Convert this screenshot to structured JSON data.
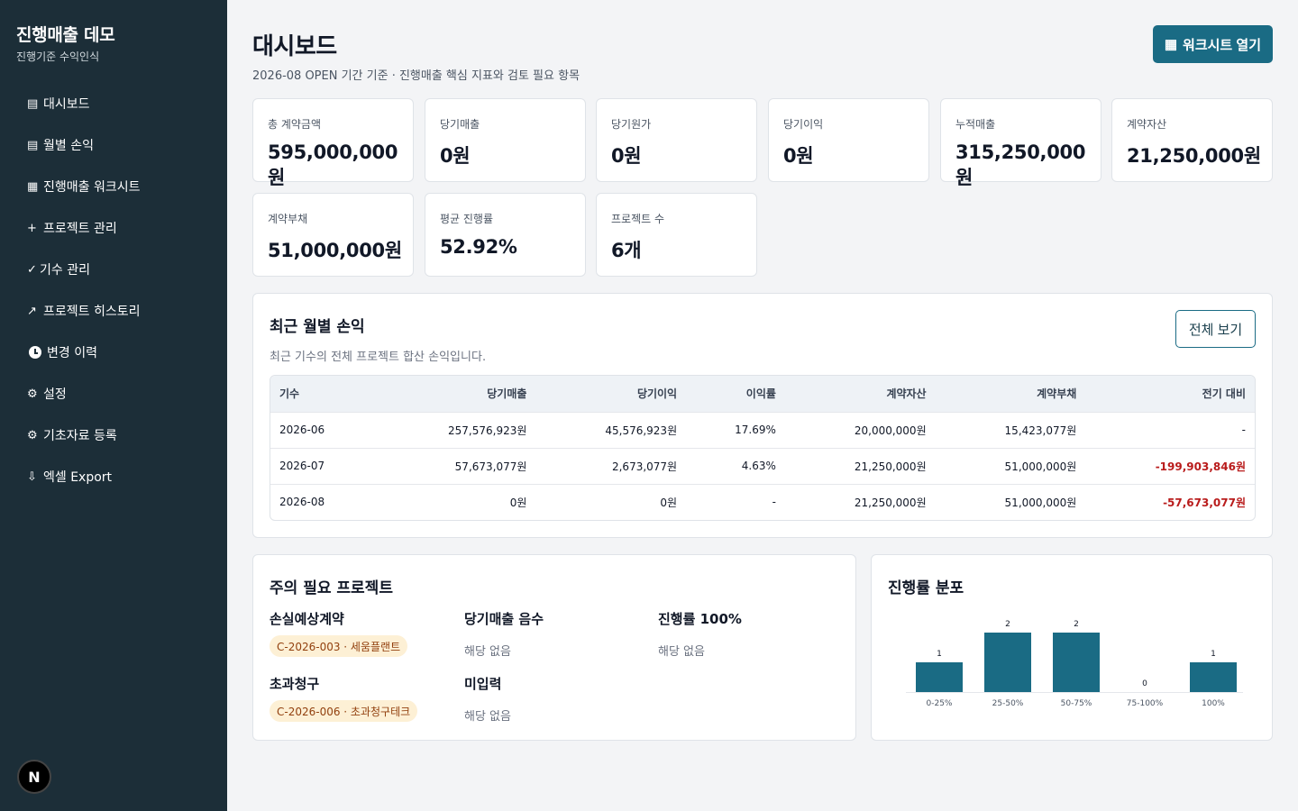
{
  "sidebar": {
    "title": "진행매출 데모",
    "subtitle": "진행기준 수익인식",
    "items": [
      {
        "icon": "▤",
        "label": "대시보드"
      },
      {
        "icon": "▤",
        "label": "월별 손익"
      },
      {
        "icon": "▦",
        "label": "진행매출 워크시트"
      },
      {
        "icon": "+",
        "label": "프로젝트 관리"
      },
      {
        "icon": "✓",
        "label": "기수 관리"
      },
      {
        "icon": "↗",
        "label": "프로젝트 히스토리"
      },
      {
        "icon": "clock",
        "label": "변경 이력"
      },
      {
        "icon": "⚙",
        "label": "설정"
      },
      {
        "icon": "⚙",
        "label": "기초자료 등록"
      },
      {
        "icon": "⇩",
        "label": "엑셀 Export"
      }
    ],
    "logo_letter": "N"
  },
  "header": {
    "title": "대시보드",
    "subtitle": "2026-08 OPEN 기간 기준 · 진행매출 핵심 지표와 검토 필요 항목",
    "worksheet_button": "워크시트 열기",
    "worksheet_icon": "▦"
  },
  "kpis": [
    {
      "label": "총 계약금액",
      "value": "595,000,000원"
    },
    {
      "label": "당기매출",
      "value": "0원"
    },
    {
      "label": "당기원가",
      "value": "0원"
    },
    {
      "label": "당기이익",
      "value": "0원"
    },
    {
      "label": "누적매출",
      "value": "315,250,000원"
    },
    {
      "label": "계약자산",
      "value": "21,250,000원"
    },
    {
      "label": "계약부채",
      "value": "51,000,000원"
    },
    {
      "label": "평균 진행률",
      "value": "52.92%"
    },
    {
      "label": "프로젝트 수",
      "value": "6개"
    }
  ],
  "monthly": {
    "title": "최근 월별 손익",
    "subtitle": "최근 기수의 전체 프로젝트 합산 손익입니다.",
    "view_all": "전체 보기",
    "columns": [
      "기수",
      "당기매출",
      "당기이익",
      "이익률",
      "계약자산",
      "계약부채",
      "전기 대비"
    ],
    "rows": [
      [
        "2026-06",
        "257,576,923원",
        "45,576,923원",
        "17.69%",
        "20,000,000원",
        "15,423,077원",
        "-"
      ],
      [
        "2026-07",
        "57,673,077원",
        "2,673,077원",
        "4.63%",
        "21,250,000원",
        "51,000,000원",
        "-199,903,846원"
      ],
      [
        "2026-08",
        "0원",
        "0원",
        "-",
        "21,250,000원",
        "51,000,000원",
        "-57,673,077원"
      ]
    ],
    "negative_color": "#b91c1c"
  },
  "attention": {
    "title": "주의 필요 프로젝트",
    "groups": {
      "loss": {
        "title": "손실예상계약",
        "pill": "C-2026-003 · 세움플랜트"
      },
      "neg_rev": {
        "title": "당기매출 음수",
        "empty": "해당 없음"
      },
      "full": {
        "title": "진행률 100%",
        "empty": "해당 없음"
      },
      "over": {
        "title": "초과청구",
        "pill": "C-2026-006 · 초과청구테크"
      },
      "missing": {
        "title": "미입력",
        "empty": "해당 없음"
      }
    }
  },
  "chart_data": {
    "type": "bar",
    "title": "진행률 분포",
    "categories": [
      "0-25%",
      "25-50%",
      "50-75%",
      "75-100%",
      "100%"
    ],
    "values": [
      1,
      2,
      2,
      0,
      1
    ],
    "ylim": [
      0,
      2
    ],
    "bar_color": "#1a6b84",
    "grid": false,
    "legend": "none"
  },
  "colors": {
    "sidebar_bg": "#1c2e38",
    "accent": "#1a6b84",
    "pill_bg": "#fdf0d5",
    "pill_text": "#92400e"
  }
}
